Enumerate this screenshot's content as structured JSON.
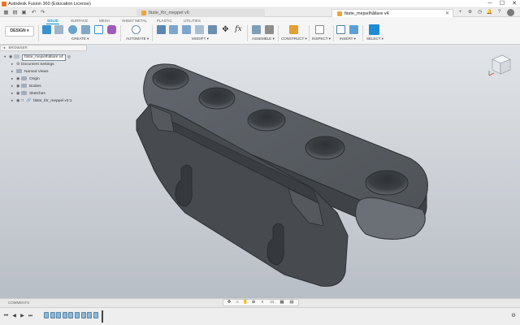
{
  "titlebar": {
    "title": "Autodesk Fusion 360 (Education License)",
    "minimize": "─",
    "maximize": "☐",
    "close": "✕"
  },
  "tabs": [
    {
      "label": "fäste_för_meppel v6",
      "active": false
    },
    {
      "label": "fäste_mejselhållare v4",
      "active": true
    }
  ],
  "toolbar": {
    "workspace_button": "DESIGN ▾",
    "workspace_tabs": [
      "SOLID",
      "SURFACE",
      "MESH",
      "SHEET METAL",
      "PLASTIC",
      "UTILITIES"
    ],
    "active_tab": "SOLID",
    "groups": [
      "CREATE ▾",
      "AUTOMATE ▾",
      "MODIFY ▾",
      "ASSEMBLE ▾",
      "CONSTRUCT ▾",
      "INSPECT ▾",
      "INSERT ▾",
      "SELECT ▾"
    ]
  },
  "browser": {
    "header": "BROWSER",
    "items": [
      {
        "label": "fäste_mejselhållare v4",
        "root": true
      },
      {
        "label": "Document Settings"
      },
      {
        "label": "Named Views"
      },
      {
        "label": "Origin"
      },
      {
        "label": "Bodies"
      },
      {
        "label": "Sketches"
      },
      {
        "label": "fäste_för_meppel v3:1"
      }
    ]
  },
  "comments": {
    "label": "COMMENTS"
  },
  "timeline": {
    "controls": [
      "⏮",
      "◀",
      "▶",
      "⏭"
    ],
    "feature_count": 9
  },
  "colors": {
    "accent": "#0696d7",
    "model": "#4b4f54",
    "viewport_bg": "#c6cbd0"
  }
}
